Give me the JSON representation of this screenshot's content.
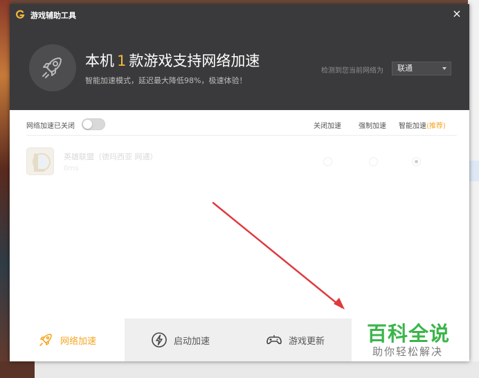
{
  "window": {
    "title": "游戏辅助工具",
    "close_glyph": "×"
  },
  "header": {
    "headline_prefix": "本机",
    "game_count": "1",
    "headline_suffix": "款游戏支持网络加速",
    "subline": "智能加速模式，延迟最大降低98%，极速体验！",
    "network_label": "检测到您当前网络为",
    "network_selected": "联通"
  },
  "toolbar": {
    "toggle_label": "网络加速已关闭",
    "toggle_on": false,
    "col_off": "关闭加速",
    "col_force": "强制加速",
    "col_smart": "智能加速",
    "col_smart_recommend": "(推荐)"
  },
  "games": [
    {
      "name": "英雄联盟（德玛西亚 网通）",
      "ping": "0ms",
      "mode": "smart"
    }
  ],
  "bottom_nav": {
    "tabs": [
      {
        "label": "网络加速",
        "icon": "rocket-icon",
        "active": true
      },
      {
        "label": "启动加速",
        "icon": "lightning-icon",
        "active": false
      },
      {
        "label": "游戏更新",
        "icon": "gamepad-icon",
        "active": false
      }
    ]
  },
  "watermark": {
    "line1": "百科全说",
    "line2": "助你轻松解决"
  },
  "colors": {
    "header_bg": "#3a3a3c",
    "accent": "#f5a623",
    "annotation_arrow": "#e0393e",
    "watermark_green": "#3bb54a"
  }
}
